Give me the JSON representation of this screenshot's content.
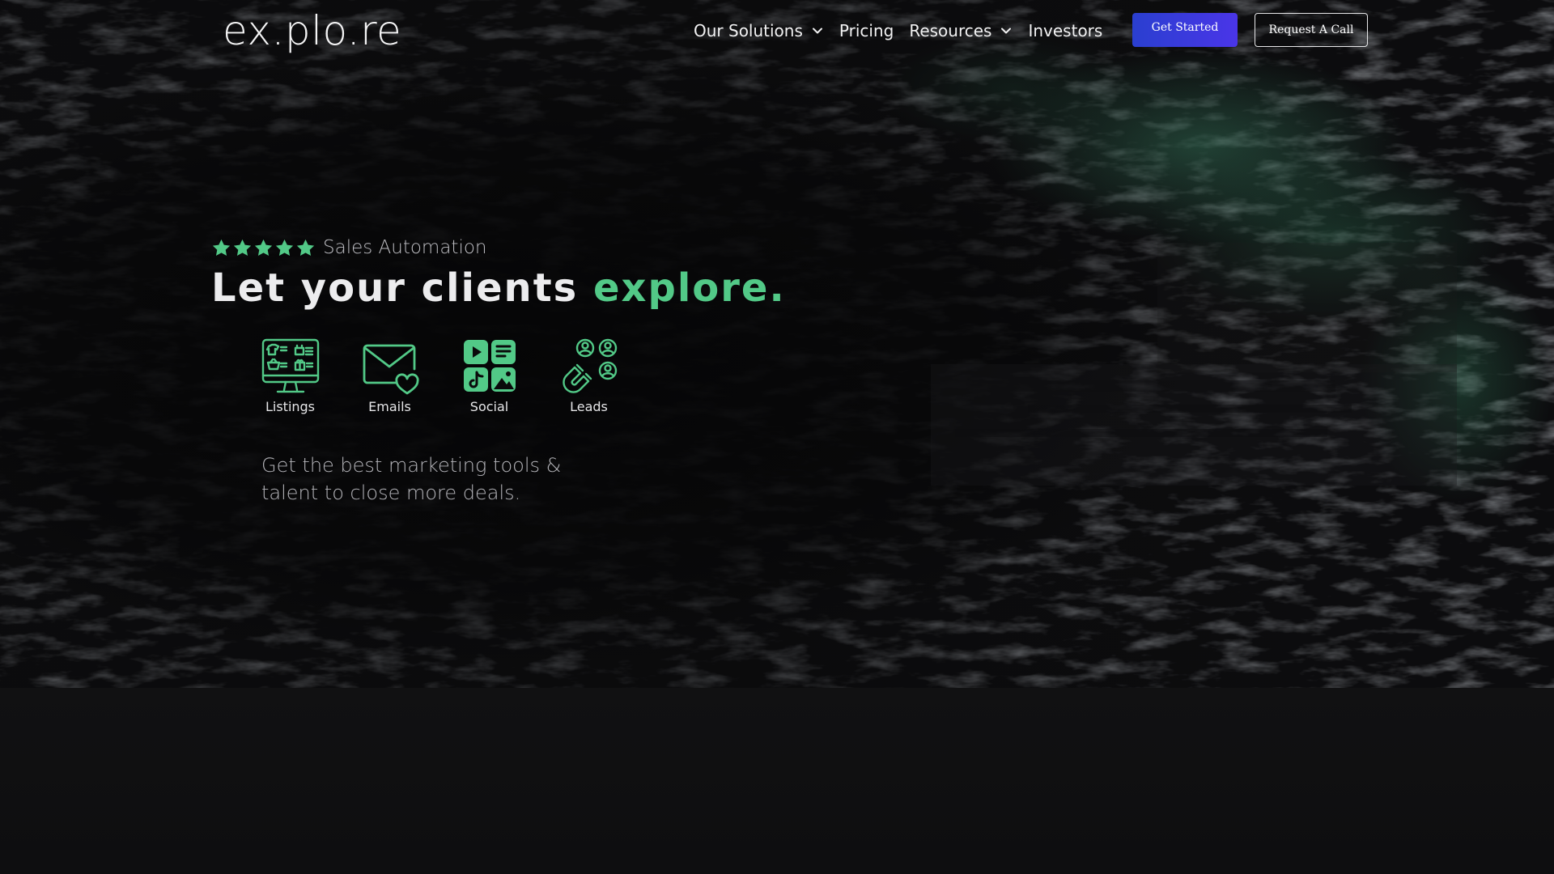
{
  "brand": {
    "logo": "ex.plo.re",
    "accent_color": "#52c987",
    "primary_button_color": "#3b3ae0"
  },
  "nav": {
    "items": [
      {
        "label": "Our Solutions",
        "has_dropdown": true
      },
      {
        "label": "Pricing",
        "has_dropdown": false
      },
      {
        "label": "Resources",
        "has_dropdown": true
      },
      {
        "label": "Investors",
        "has_dropdown": false
      }
    ],
    "get_started_label": "Get Started",
    "request_call_label": "Request A Call"
  },
  "hero": {
    "rating_stars": 5,
    "tagline": "Sales Automation",
    "headline_main": "Let your clients ",
    "headline_accent": "explore.",
    "features": [
      {
        "label": "Listings",
        "icon": "monitor-listings-icon"
      },
      {
        "label": "Emails",
        "icon": "mail-heart-icon"
      },
      {
        "label": "Social",
        "icon": "social-grid-icon"
      },
      {
        "label": "Leads",
        "icon": "magnet-users-icon"
      }
    ],
    "description": "Get the best marketing tools & talent to close more deals."
  }
}
